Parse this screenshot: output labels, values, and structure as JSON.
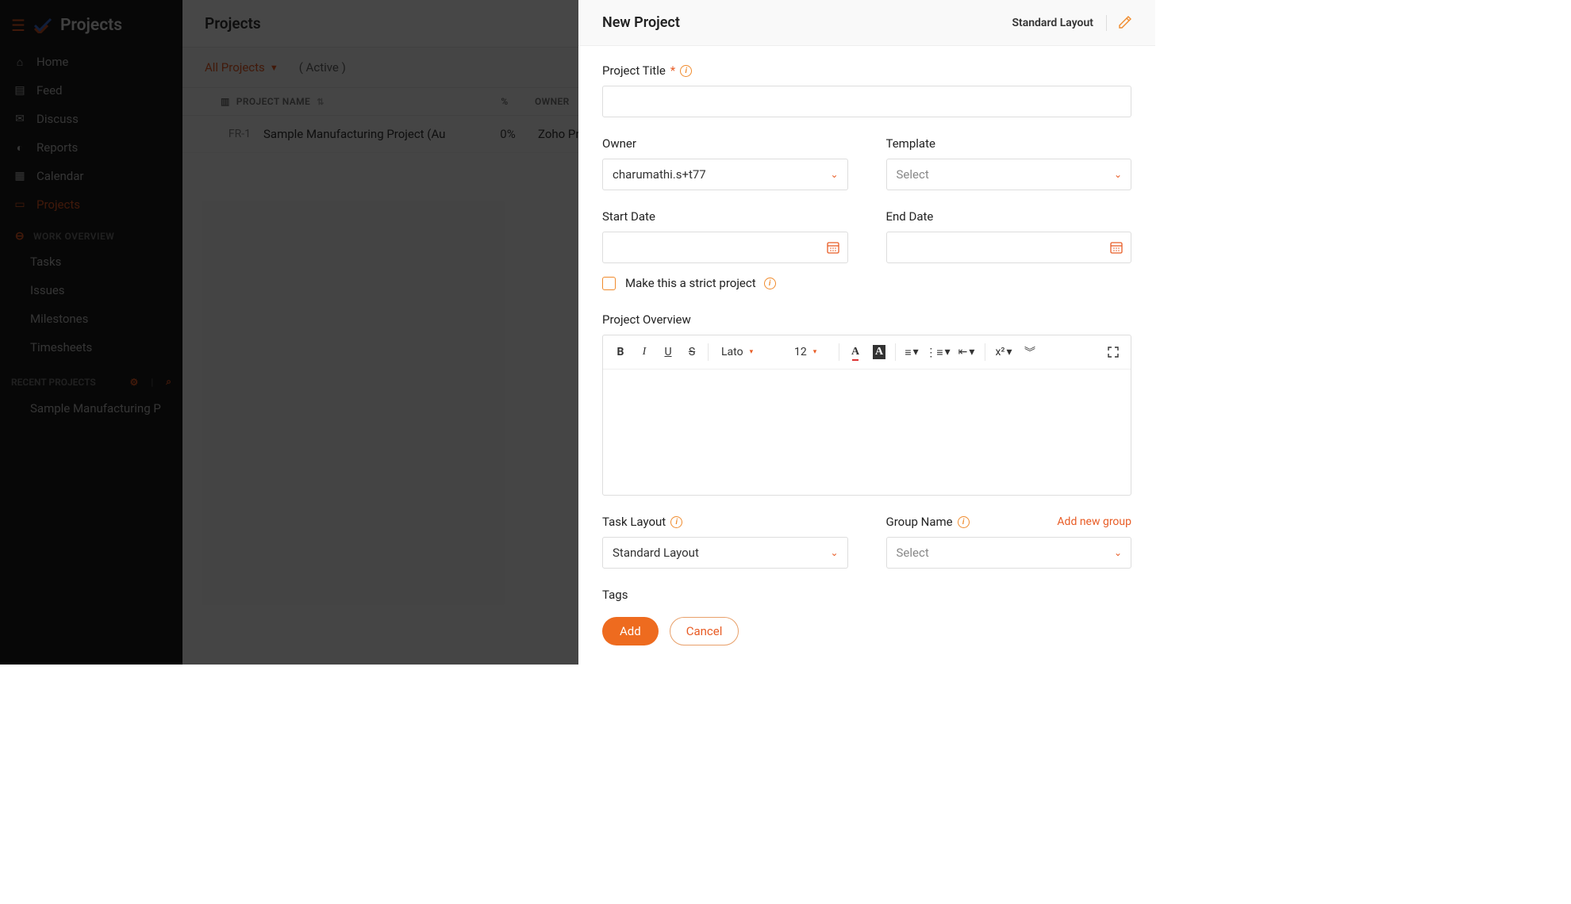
{
  "brand": "Projects",
  "sidebar": {
    "items": [
      {
        "label": "Home"
      },
      {
        "label": "Feed"
      },
      {
        "label": "Discuss"
      },
      {
        "label": "Reports"
      },
      {
        "label": "Calendar"
      },
      {
        "label": "Projects"
      }
    ],
    "work_overview_label": "WORK OVERVIEW",
    "work_items": [
      {
        "label": "Tasks"
      },
      {
        "label": "Issues"
      },
      {
        "label": "Milestones"
      },
      {
        "label": "Timesheets"
      }
    ],
    "recent_label": "RECENT PROJECTS",
    "recent_items": [
      {
        "label": "Sample Manufacturing P"
      }
    ]
  },
  "main": {
    "title": "Projects",
    "filter": "All Projects",
    "status": "( Active )",
    "columns": {
      "name": "PROJECT NAME",
      "pct": "%",
      "owner": "OWNER"
    },
    "rows": [
      {
        "id": "FR-1",
        "name": "Sample Manufacturing Project (Au",
        "pct": "0%",
        "owner": "Zoho Project"
      }
    ]
  },
  "panel": {
    "title": "New Project",
    "layout_name": "Standard Layout",
    "fields": {
      "project_title": "Project Title",
      "owner": "Owner",
      "owner_value": "charumathi.s+t77",
      "template": "Template",
      "template_value": "Select",
      "start_date": "Start Date",
      "end_date": "End Date",
      "strict": "Make this a strict project",
      "overview": "Project Overview",
      "task_layout": "Task Layout",
      "task_layout_value": "Standard Layout",
      "group_name": "Group Name",
      "group_value": "Select",
      "add_group": "Add new group",
      "tags": "Tags"
    },
    "rte": {
      "font": "Lato",
      "size": "12",
      "sup": "x²"
    },
    "buttons": {
      "add": "Add",
      "cancel": "Cancel"
    }
  }
}
